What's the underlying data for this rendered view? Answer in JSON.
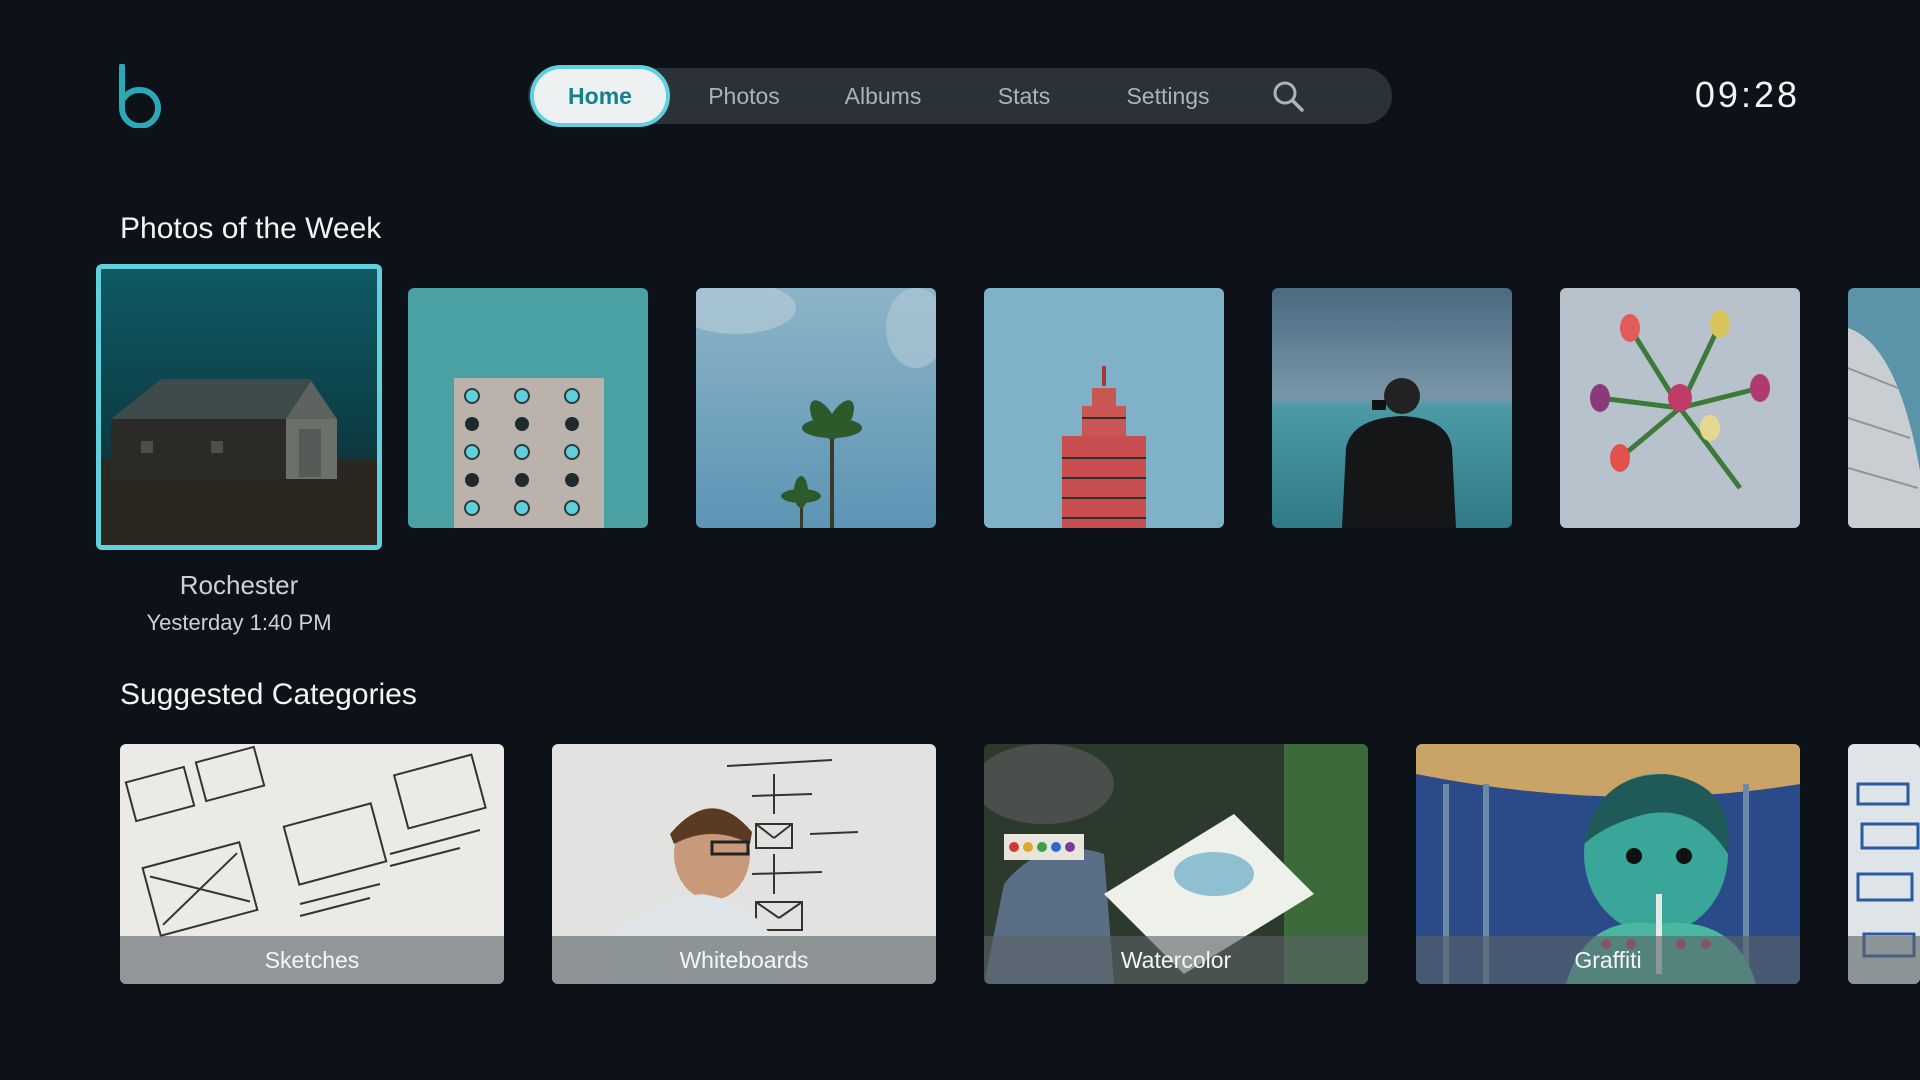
{
  "header": {
    "logo_alt": "b",
    "nav": {
      "items": [
        {
          "label": "Home",
          "active": true
        },
        {
          "label": "Photos",
          "active": false
        },
        {
          "label": "Albums",
          "active": false
        },
        {
          "label": "Stats",
          "active": false
        },
        {
          "label": "Settings",
          "active": false
        }
      ],
      "search_icon": "search-icon"
    },
    "clock": "09:28"
  },
  "photos_of_week": {
    "title": "Photos of the Week",
    "items": [
      {
        "subject": "barn"
      },
      {
        "subject": "building-facade"
      },
      {
        "subject": "palm-trees"
      },
      {
        "subject": "red-tower"
      },
      {
        "subject": "man-with-phone-by-sea"
      },
      {
        "subject": "tulip-bouquet"
      },
      {
        "subject": "dome-architecture"
      }
    ],
    "focused_caption": {
      "title": "Rochester",
      "date": "Yesterday 1:40 PM"
    }
  },
  "suggested_categories": {
    "title": "Suggested Categories",
    "items": [
      {
        "label": "Sketches"
      },
      {
        "label": "Whiteboards"
      },
      {
        "label": "Watercolor"
      },
      {
        "label": "Graffiti"
      },
      {
        "label": ""
      }
    ]
  },
  "colors": {
    "background": "#0c1217",
    "accent": "#5fd0dc",
    "nav_bg": "#2a3238",
    "active_text": "#13808c"
  }
}
